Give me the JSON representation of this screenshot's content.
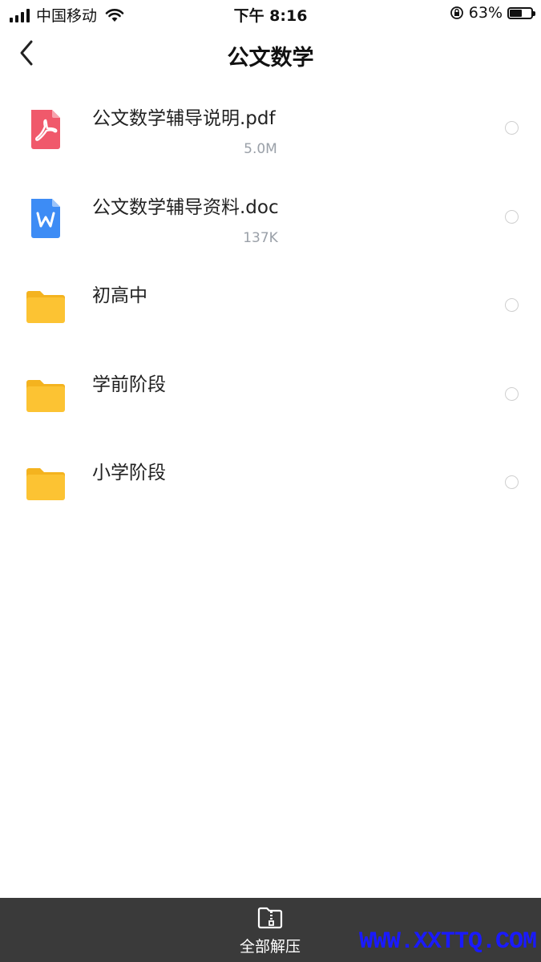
{
  "status_bar": {
    "carrier": "中国移动",
    "time": "下午 8:16",
    "battery": "63%",
    "battery_level": 0.63
  },
  "nav": {
    "title": "公文数学"
  },
  "files": [
    {
      "name": "公文数学辅导说明.pdf",
      "size": "5.0M",
      "icon": "pdf-icon"
    },
    {
      "name": "公文数学辅导资料.doc",
      "size": "137K",
      "icon": "word-doc-icon"
    },
    {
      "name": "初高中",
      "size": "",
      "icon": "folder-icon"
    },
    {
      "name": "学前阶段",
      "size": "",
      "icon": "folder-icon"
    },
    {
      "name": "小学阶段",
      "size": "",
      "icon": "folder-icon"
    }
  ],
  "bottom": {
    "extract_all": "全部解压",
    "watermark": "WWW.XXTTQ.COM"
  },
  "colors": {
    "pdf": "#f0596b",
    "doc": "#3d8cf5",
    "folder": "#fcc333",
    "bottom_bar": "#3a3a3a",
    "watermark": "#1a1aff"
  }
}
